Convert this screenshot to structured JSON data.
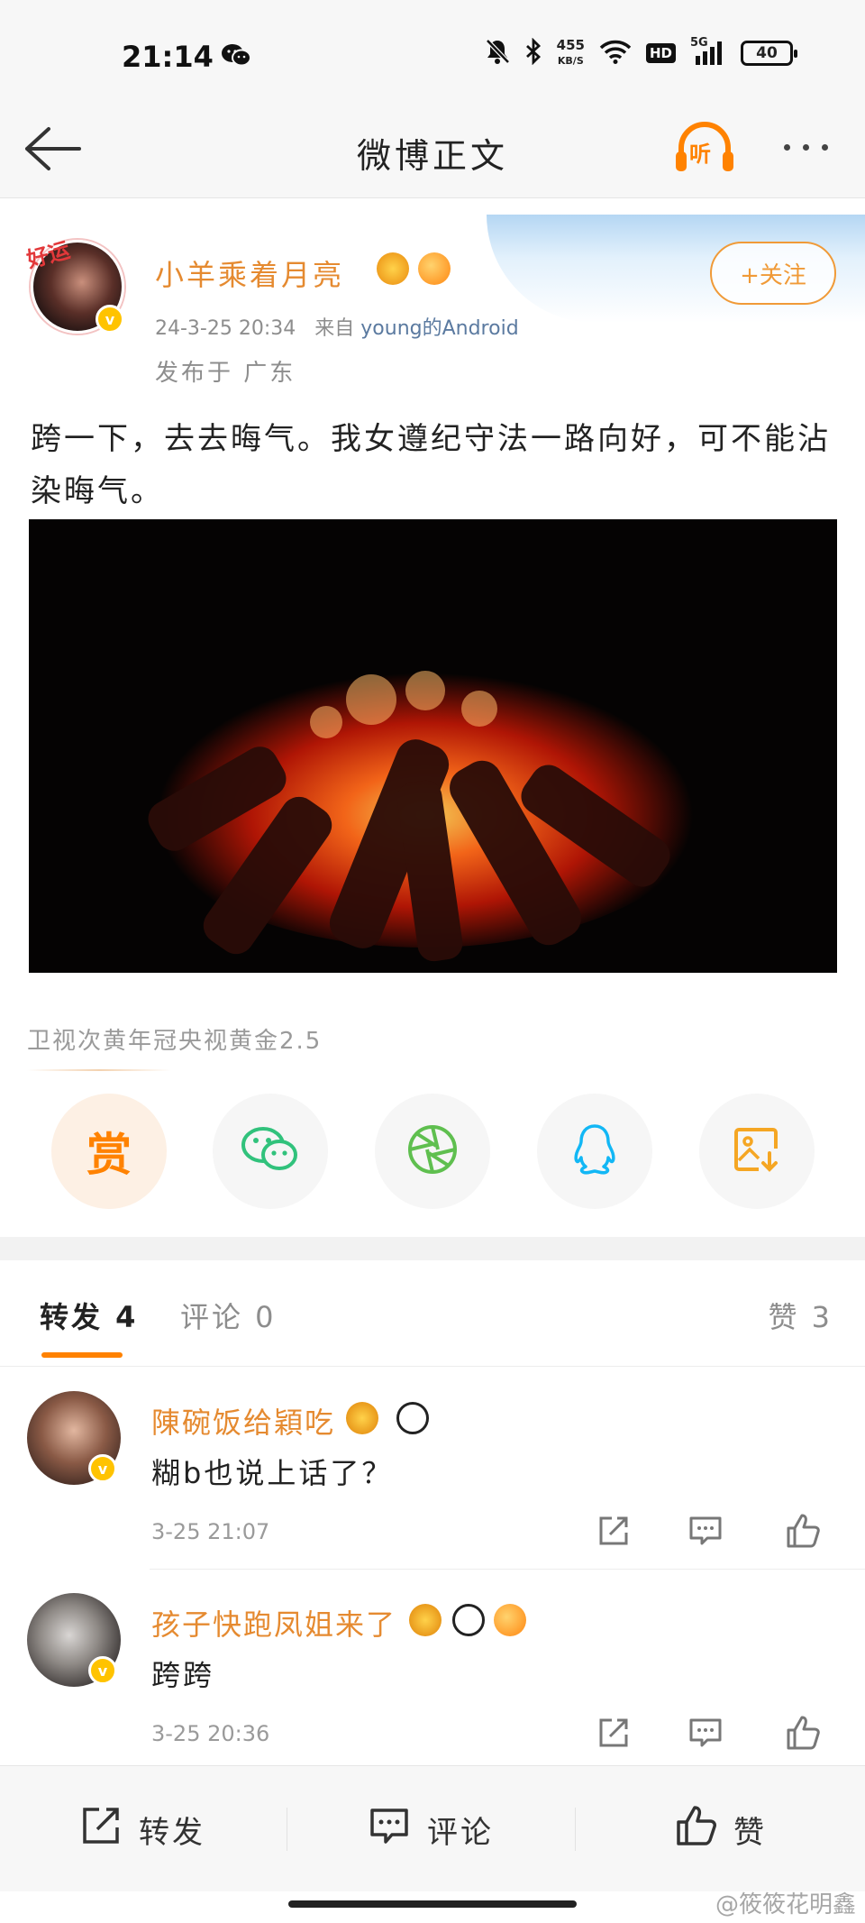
{
  "status_bar": {
    "time": "21:14",
    "net_speed_value": "455",
    "net_speed_unit": "KB/S",
    "hd_label": "HD",
    "signal_label": "5G",
    "battery": "40",
    "icons": [
      "wechat-icon",
      "mute-icon",
      "bluetooth-icon",
      "wifi-icon",
      "signal-icon"
    ]
  },
  "nav": {
    "title": "微博正文",
    "listen_label": "听",
    "accent_color": "#ff8200"
  },
  "post": {
    "author": "小羊乘着月亮",
    "avatar_badge": "好运",
    "verified_mark": "v",
    "time": "24-3-25 20:34",
    "source_prefix": "来自",
    "source": "young的Android",
    "location": "发布于 广东",
    "follow_label": "+关注",
    "text": "跨一下，去去晦气。我女遵纪守法一路向好，可不能沾染晦气。",
    "image_alt": "burning charcoal fire",
    "topic": "卫视次黄年冠央视黄金2.5",
    "reward_label": "赏",
    "share_icons": [
      "wechat-icon",
      "moments-icon",
      "qq-icon",
      "save-image-icon"
    ]
  },
  "tabs": {
    "repost": "转发 4",
    "comment": "评论 0",
    "like": "赞 3"
  },
  "reposts": [
    {
      "name": "陳碗饭给穎吃",
      "text": "糊b也说上话了？",
      "time": "3-25 21:07",
      "verified_mark": "v"
    },
    {
      "name": "孩子快跑凤姐来了",
      "text": "跨跨",
      "time": "3-25 20:36",
      "verified_mark": "v"
    }
  ],
  "bottom_bar": {
    "repost": "转发",
    "comment": "评论",
    "like": "赞"
  },
  "watermark": "@筱筱花明鑫"
}
